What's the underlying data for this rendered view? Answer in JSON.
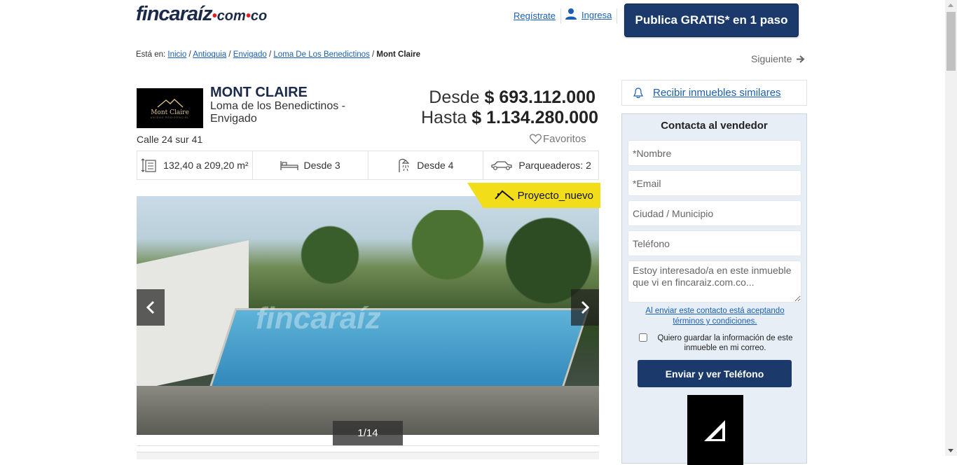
{
  "header": {
    "logo_main": "fincaraíz",
    "logo_domain": "com",
    "logo_tld": "co",
    "register_label": "Regístrate",
    "login_label": "Ingresa",
    "publish_label": "Publica GRATIS* en 1 paso"
  },
  "breadcrumb": {
    "prefix": "Está en:",
    "items": [
      "Inicio",
      "Antioquia",
      "Envigado",
      "Loma De Los Benedictinos"
    ],
    "current": "Mont Claire"
  },
  "next_label": "Siguiente",
  "project": {
    "logo_text": "Mont Claire",
    "logo_subtext": "UNIDAD RESIDENCIAL",
    "title": "MONT CLAIRE",
    "location": "Loma de los Benedictinos - Envigado",
    "price_from_label": "Desde",
    "price_from": "$ 693.112.000",
    "price_to_label": "Hasta",
    "price_to": "$ 1.134.280.000",
    "address": "Calle 24 sur 41",
    "favorites_label": "Favoritos"
  },
  "features": [
    {
      "icon": "area-icon",
      "text": "132,40 a 209,20 m²"
    },
    {
      "icon": "bed-icon",
      "text": "Desde  3"
    },
    {
      "icon": "shower-icon",
      "text": "Desde  4"
    },
    {
      "icon": "car-icon",
      "text": "Parqueaderos: 2"
    }
  ],
  "gallery": {
    "badge": "Proyecto_nuevo",
    "counter": "1/14",
    "watermark": "fincaraíz"
  },
  "sidebar": {
    "similar_label": "Recibir inmuebles similares",
    "contact_title": "Contacta al vendedor",
    "name_placeholder": "*Nombre",
    "email_placeholder": "*Email",
    "city_placeholder": "Ciudad / Municipio",
    "phone_placeholder": "Teléfono",
    "message_placeholder": "Estoy interesado/a en este inmueble que vi en fincaraiz.com.co...",
    "terms_text": "Al enviar este contacto está aceptando términos y condiciones.",
    "save_info_label": "Quiero guardar la información de este inmueble en mi correo.",
    "send_label": "Enviar y ver Teléfono"
  },
  "colors": {
    "brand_navy": "#1b3a6b",
    "link_blue": "#1a5fb4",
    "badge_yellow": "#f2dd1a",
    "contact_bg": "#e7eef6"
  }
}
